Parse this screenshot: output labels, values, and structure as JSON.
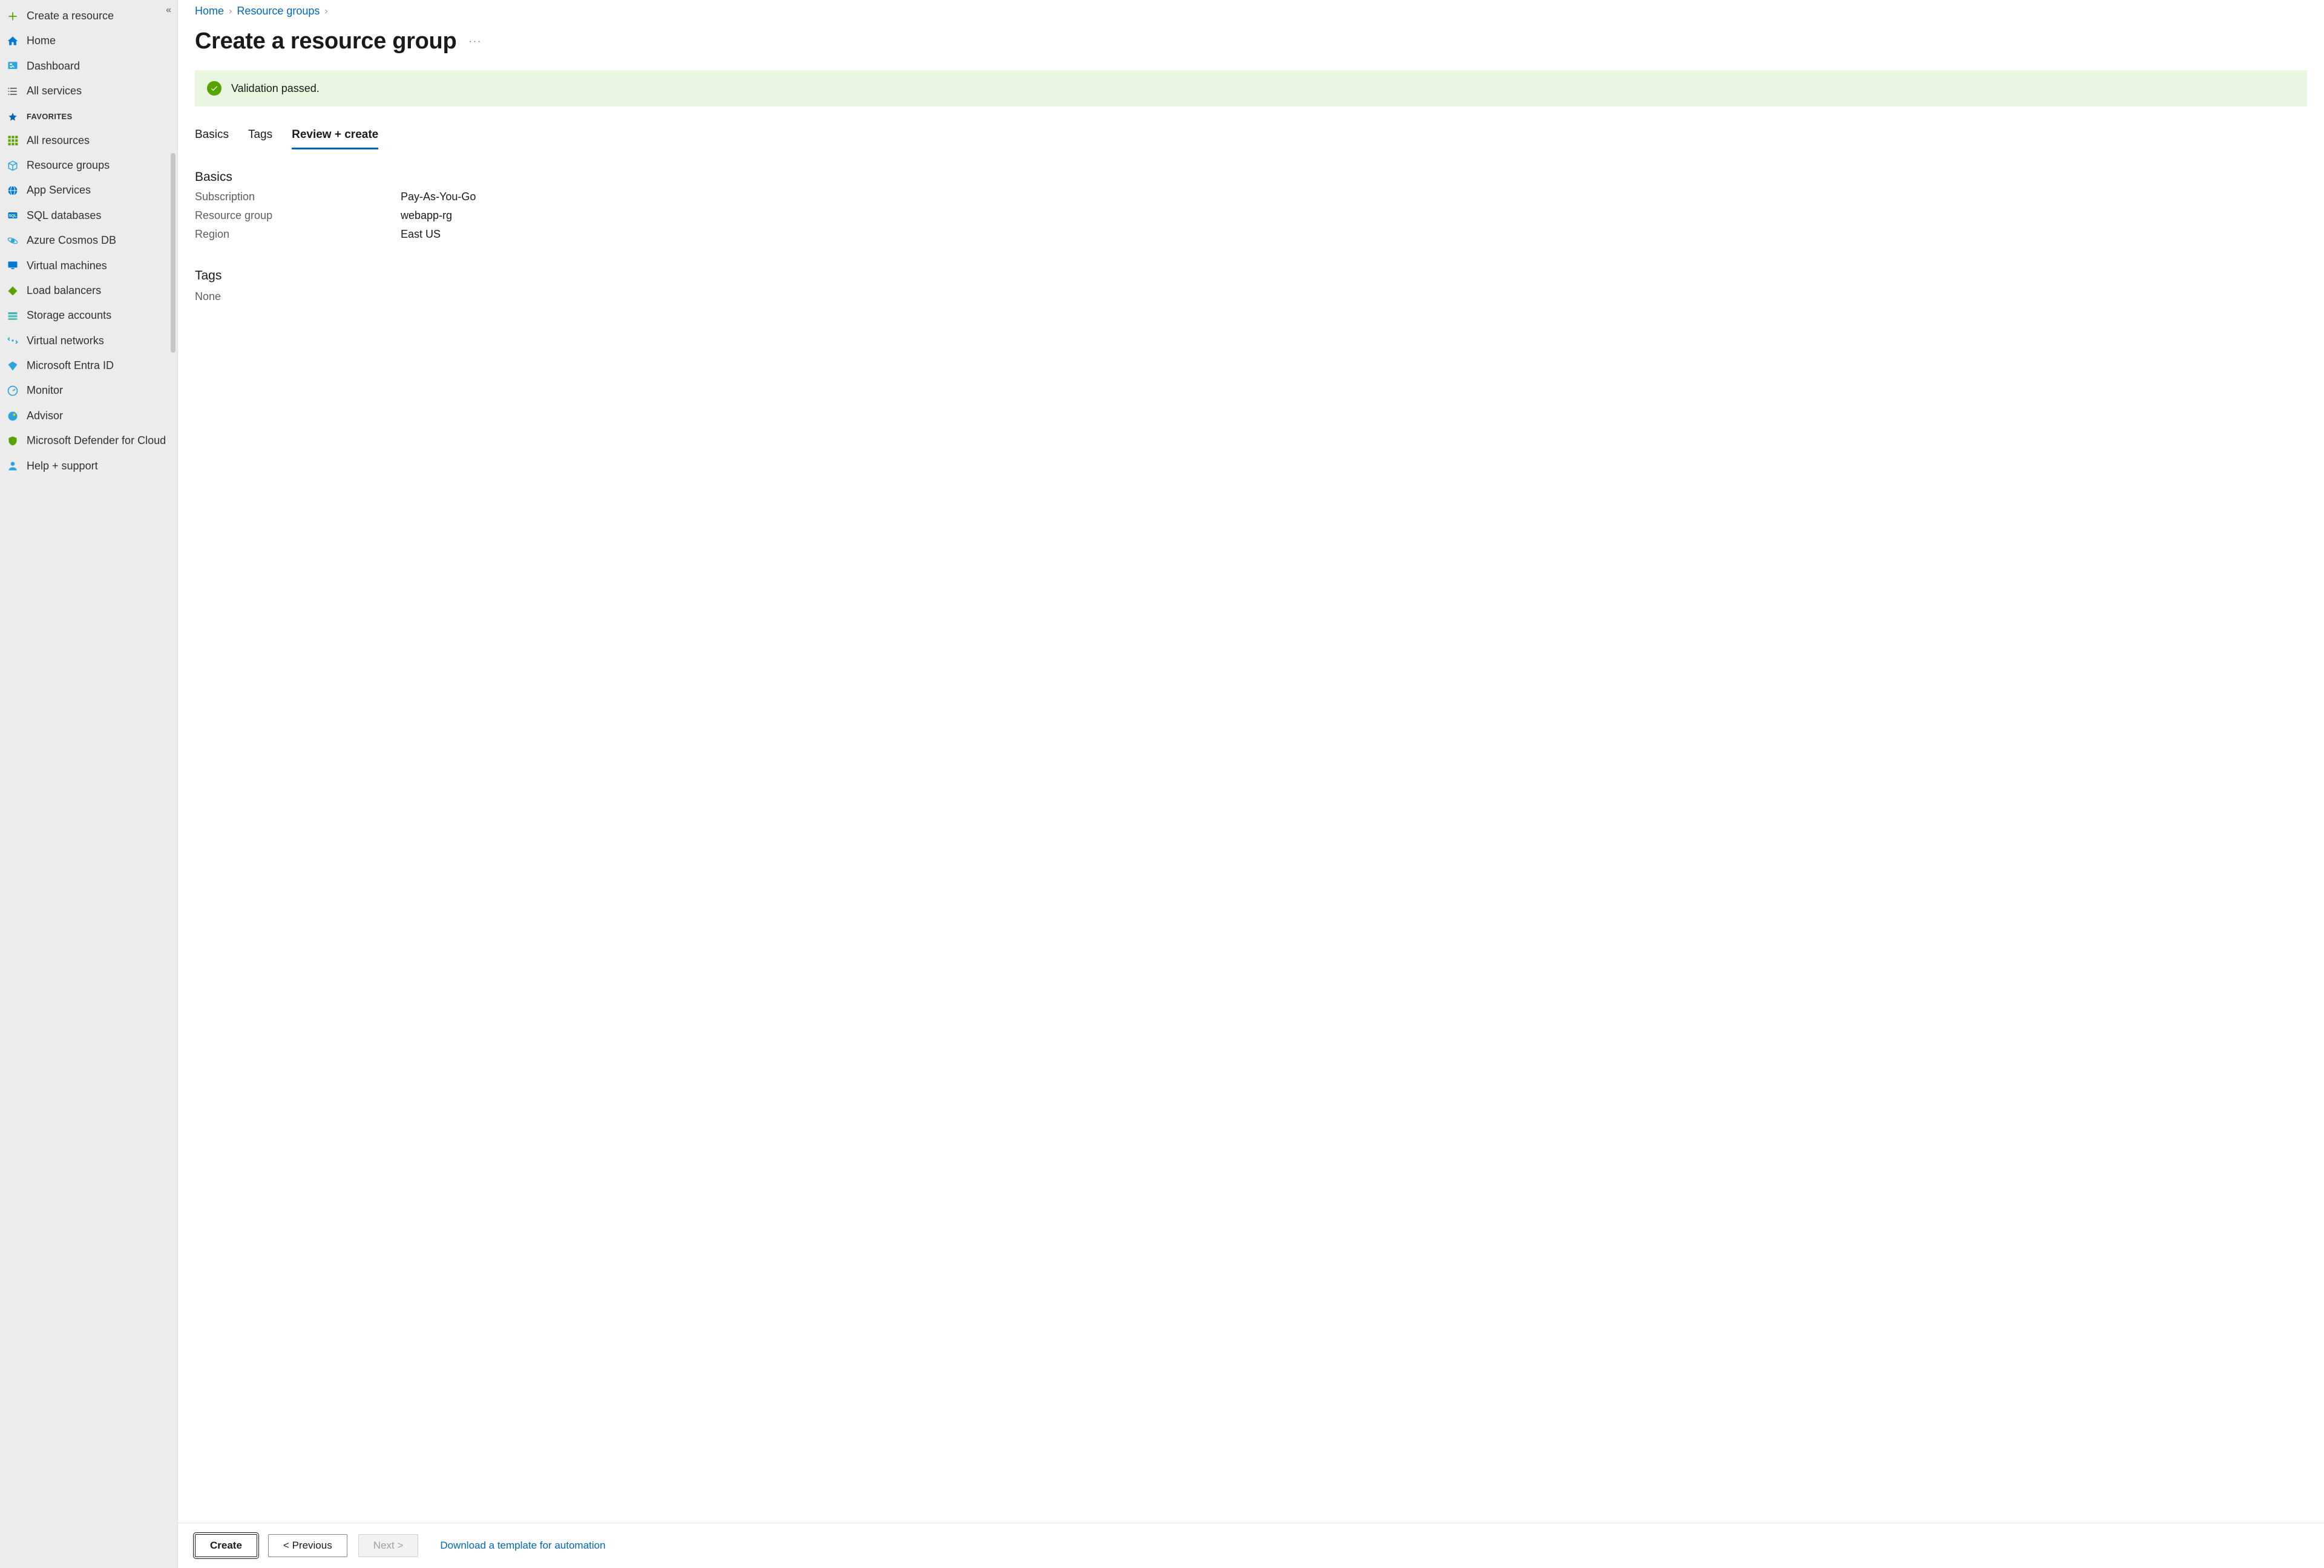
{
  "sidebar": {
    "collapse_tooltip": "«",
    "top_items": [
      {
        "label": "Create a resource",
        "icon": "plus-icon"
      },
      {
        "label": "Home",
        "icon": "home-icon"
      },
      {
        "label": "Dashboard",
        "icon": "dashboard-icon"
      },
      {
        "label": "All services",
        "icon": "list-icon"
      }
    ],
    "favorites_label": "FAVORITES",
    "favorites_icon": "star-icon",
    "favorites": [
      {
        "label": "All resources",
        "icon": "grid-icon",
        "icon_color": "#57a300"
      },
      {
        "label": "Resource groups",
        "icon": "cube-outline-icon",
        "icon_color": "#2aa3de"
      },
      {
        "label": "App Services",
        "icon": "globe-icon",
        "icon_color": "#0078d4"
      },
      {
        "label": "SQL databases",
        "icon": "sql-icon",
        "icon_color": "#0078d4"
      },
      {
        "label": "Azure Cosmos DB",
        "icon": "cosmos-icon",
        "icon_color": "#2aa3de"
      },
      {
        "label": "Virtual machines",
        "icon": "monitor-icon",
        "icon_color": "#0078d4"
      },
      {
        "label": "Load balancers",
        "icon": "diamond-icon",
        "icon_color": "#57a300"
      },
      {
        "label": "Storage accounts",
        "icon": "storage-icon",
        "icon_color": "#3cb4ac"
      },
      {
        "label": "Virtual networks",
        "icon": "vnet-icon",
        "icon_color": "#2aa3de"
      },
      {
        "label": "Microsoft Entra ID",
        "icon": "entra-icon",
        "icon_color": "#2aa3de"
      },
      {
        "label": "Monitor",
        "icon": "gauge-icon",
        "icon_color": "#2aa3de"
      },
      {
        "label": "Advisor",
        "icon": "advisor-icon",
        "icon_color": "#2aa3de"
      },
      {
        "label": "Microsoft Defender for Cloud",
        "icon": "shield-icon",
        "icon_color": "#57a300"
      },
      {
        "label": "Help + support",
        "icon": "support-icon",
        "icon_color": "#2aa3de"
      }
    ]
  },
  "breadcrumb": {
    "items": [
      "Home",
      "Resource groups"
    ]
  },
  "page": {
    "title": "Create a resource group",
    "more_tooltip": "···"
  },
  "validation": {
    "status": "passed",
    "message": "Validation passed."
  },
  "tabs": {
    "items": [
      "Basics",
      "Tags",
      "Review + create"
    ],
    "active_index": 2
  },
  "review": {
    "basics_title": "Basics",
    "basics": [
      {
        "k": "Subscription",
        "v": "Pay-As-You-Go"
      },
      {
        "k": "Resource group",
        "v": "webapp-rg"
      },
      {
        "k": "Region",
        "v": "East US"
      }
    ],
    "tags_title": "Tags",
    "tags_value": "None"
  },
  "footer": {
    "create_label": "Create",
    "previous_label": "< Previous",
    "next_label": "Next >",
    "download_label": "Download a template for automation"
  }
}
